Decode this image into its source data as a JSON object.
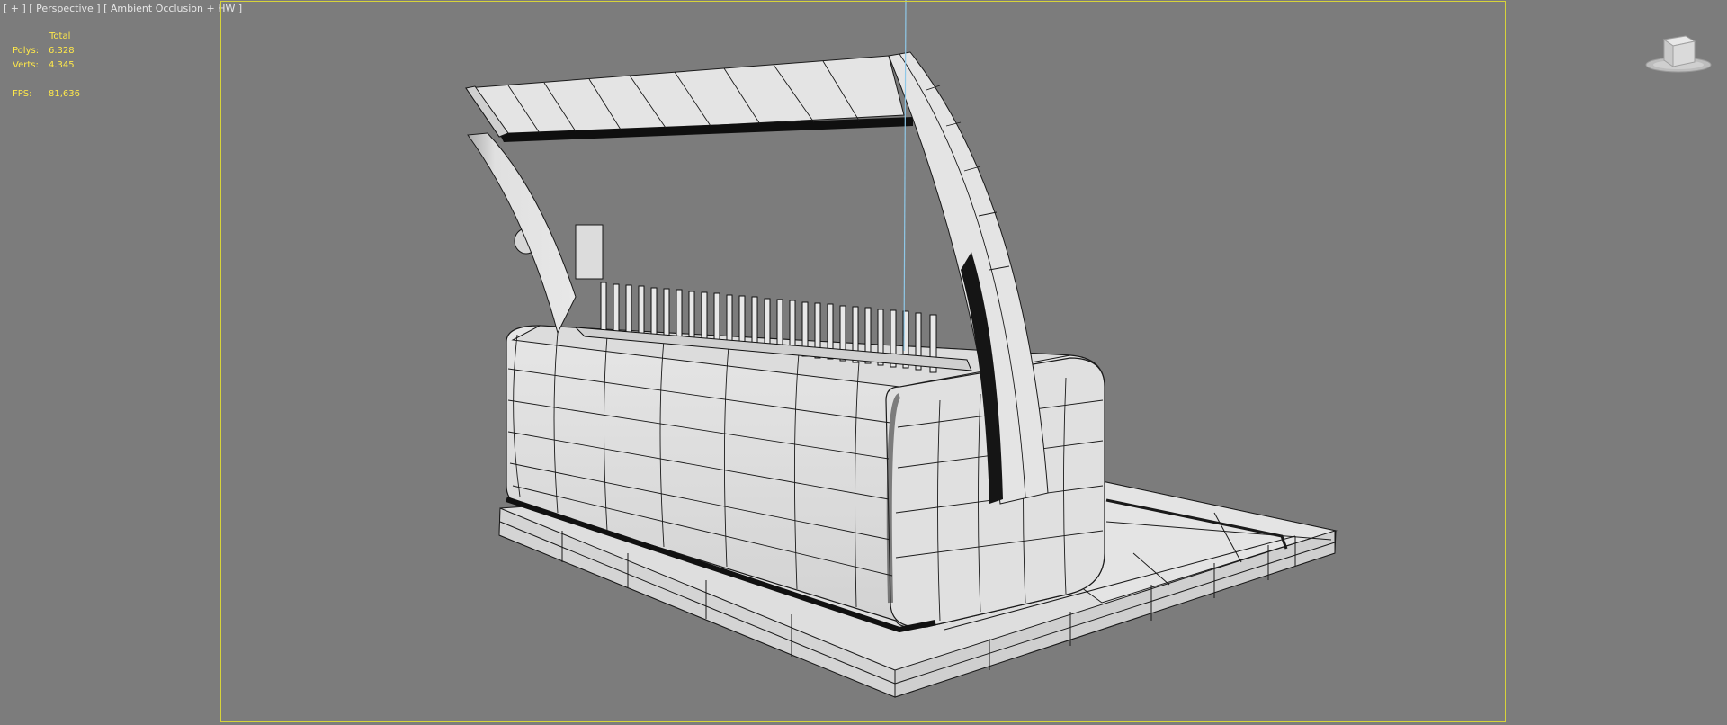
{
  "viewport": {
    "label": "[ + ] [ Perspective ] [ Ambient Occlusion + HW ]",
    "menu_plus": "[ + ]",
    "view": "[ Perspective ]",
    "shading": "[ Ambient Occlusion + HW ]"
  },
  "stats": {
    "header": "Total",
    "polys_label": "Polys:",
    "polys_value": "6.328",
    "verts_label": "Verts:",
    "verts_value": "4.345",
    "fps_label": "FPS:",
    "fps_value": "81,636"
  },
  "colors": {
    "background": "#7c7c7c",
    "stats_text": "#ffe94a",
    "safe_frame": "#d7d33a",
    "axis_line": "#8fc8e8",
    "mesh_fill": "#e4e4e4",
    "wire": "#1a1a1a"
  },
  "icons": {
    "viewcube": "viewcube-icon"
  }
}
